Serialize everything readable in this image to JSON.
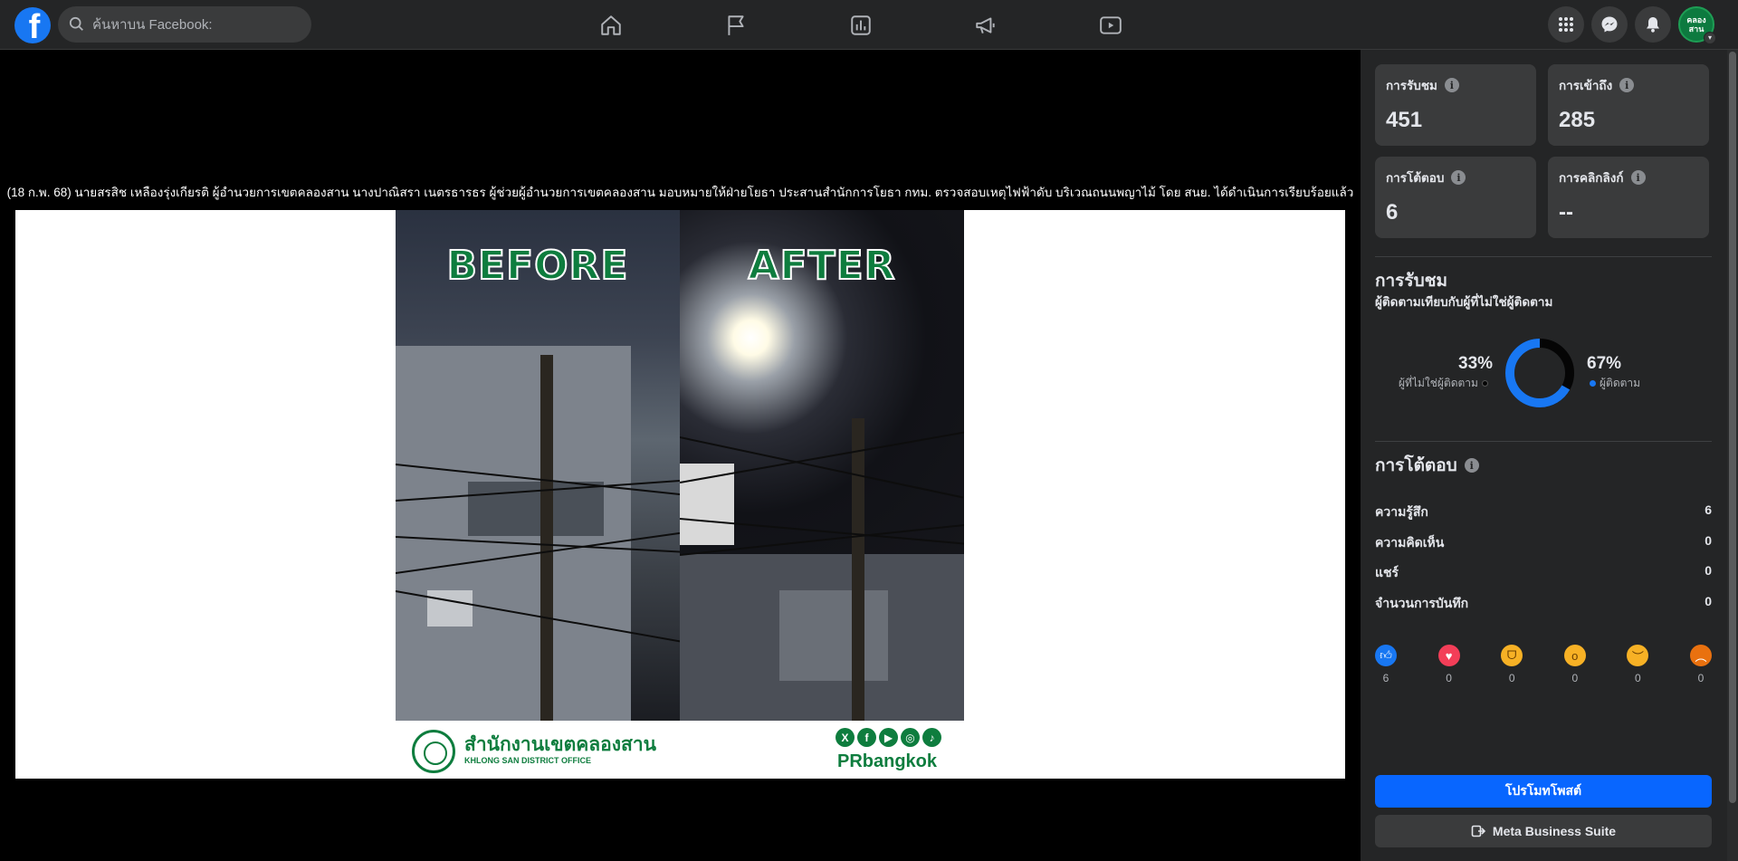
{
  "topbar": {
    "logo_letter": "f",
    "search_placeholder": "ค้นหาบน Facebook:",
    "avatar_line1": "คลอง",
    "avatar_line2": "สาน"
  },
  "post": {
    "caption": "(18 ก.พ. 68) นายสรสิช เหลืองรุ่งเกียรติ ผู้อำนวยการเขตคลองสาน นางปาณิสรา เนตรธารธร ผู้ช่วยผู้อำนวยการเขตคลองสาน มอบหมายให้ฝ่ายโยธา ประสานสำนักการโยธา กทม. ตรวจสอบเหตุไฟฟ้าดับ บริเวณถนนพญาไม้ โดย สนย. ได้ดำเนินการเรียบร้อยแล้ว",
    "image": {
      "before_label": "BEFORE",
      "after_label": "AFTER",
      "office_th": "สำนักงานเขตคลองสาน",
      "office_en": "KHLONG SAN DISTRICT OFFICE",
      "brand": "PRbangkok",
      "social_glyphs": [
        "X",
        "f",
        "▶",
        "◎",
        "♪"
      ]
    }
  },
  "insights": {
    "stats": [
      {
        "label": "การรับชม",
        "value": "451"
      },
      {
        "label": "การเข้าถึง",
        "value": "285"
      },
      {
        "label": "การโต้ตอบ",
        "value": "6"
      },
      {
        "label": "การคลิกลิงก์",
        "value": "--"
      }
    ],
    "views_title": "การรับชม",
    "views_subtitle": "ผู้ติดตามเทียบกับผู้ที่ไม่ใช่ผู้ติดตาม",
    "non_followers_pct": "33%",
    "non_followers_label": "ผู้ที่ไม่ใช่ผู้ติดตาม",
    "followers_pct": "67%",
    "followers_label": "ผู้ติดตาม",
    "followers_fraction": 0.67,
    "engagement_title": "การโต้ตอบ",
    "rows": [
      {
        "label": "ความรู้สึก",
        "value": "6"
      },
      {
        "label": "ความคิดเห็น",
        "value": "0"
      },
      {
        "label": "แชร์",
        "value": "0"
      },
      {
        "label": "จำนวนการบันทึก",
        "value": "0"
      }
    ],
    "reactions": [
      {
        "name": "like",
        "count": "6"
      },
      {
        "name": "love",
        "count": "0"
      },
      {
        "name": "haha",
        "count": "0"
      },
      {
        "name": "wow",
        "count": "0"
      },
      {
        "name": "sad",
        "count": "0"
      },
      {
        "name": "angry",
        "count": "0"
      }
    ],
    "promote_label": "โปรโมทโพสต์",
    "mbs_label": "Meta Business Suite"
  },
  "colors": {
    "accent": "#0866ff",
    "followers": "#1877f2",
    "non_followers": "#050505",
    "brand_green": "#0e7d3e"
  }
}
